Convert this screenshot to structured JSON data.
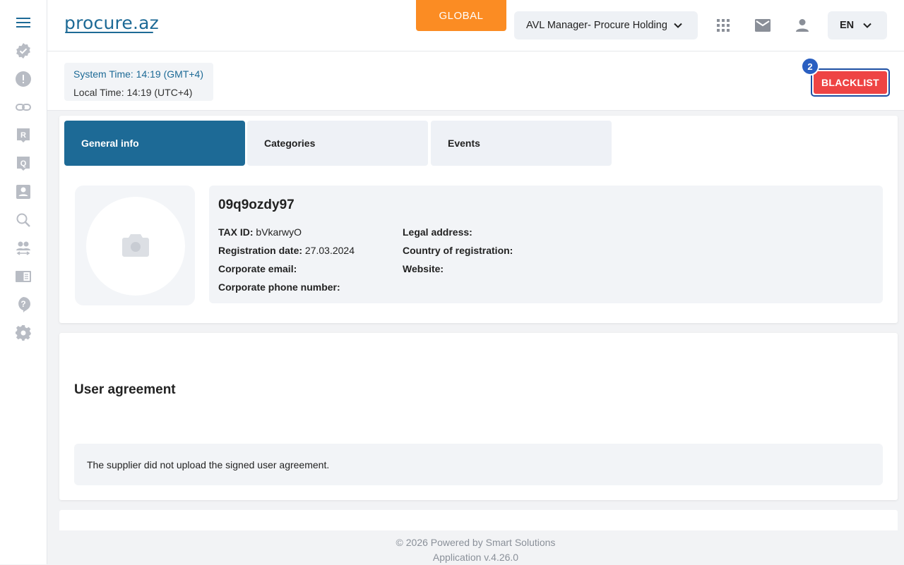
{
  "sidebar": {
    "items": [
      {
        "icon": "menu-icon"
      },
      {
        "icon": "verified-badge-icon"
      },
      {
        "icon": "alert-icon"
      },
      {
        "icon": "link-icon"
      },
      {
        "icon": "r-square-icon"
      },
      {
        "icon": "q-square-icon"
      },
      {
        "icon": "contact-card-icon"
      },
      {
        "icon": "search-icon"
      },
      {
        "icon": "users-exchange-icon"
      },
      {
        "icon": "book-icon"
      },
      {
        "icon": "help-icon"
      },
      {
        "icon": "gear-icon"
      }
    ]
  },
  "header": {
    "logo_text": "procure.az",
    "global_label": "GLOBAL",
    "org_selector": "AVL Manager- Procure Holding",
    "language": "EN",
    "colors": {
      "brand": "#1d6a96",
      "global": "#fb8c23",
      "danger": "#ee4444"
    }
  },
  "timebar": {
    "system_time": "System Time: 14:19 (GMT+4)",
    "local_time": "Local Time: 14:19 (UTC+4)",
    "blacklist_label": "BLACKLIST",
    "blacklist_badge": "2"
  },
  "tabs": [
    {
      "label": "General info",
      "active": true
    },
    {
      "label": "Categories",
      "active": false
    },
    {
      "label": "Events",
      "active": false
    }
  ],
  "company": {
    "name": "09q9ozdy97",
    "tax_id_label": "TAX ID:",
    "tax_id_value": "bVkarwyO",
    "registration_date_label": "Registration date:",
    "registration_date_value": "27.03.2024",
    "corporate_email_label": "Corporate email:",
    "corporate_phone_label": "Corporate phone number:",
    "legal_address_label": "Legal address:",
    "country_label": "Country of registration:",
    "website_label": "Website:"
  },
  "user_agreement": {
    "title": "User agreement",
    "message": "The supplier did not upload the signed user agreement."
  },
  "footer": {
    "line1": "© 2026 Powered by Smart Solutions",
    "line2": "Application v.4.26.0"
  }
}
